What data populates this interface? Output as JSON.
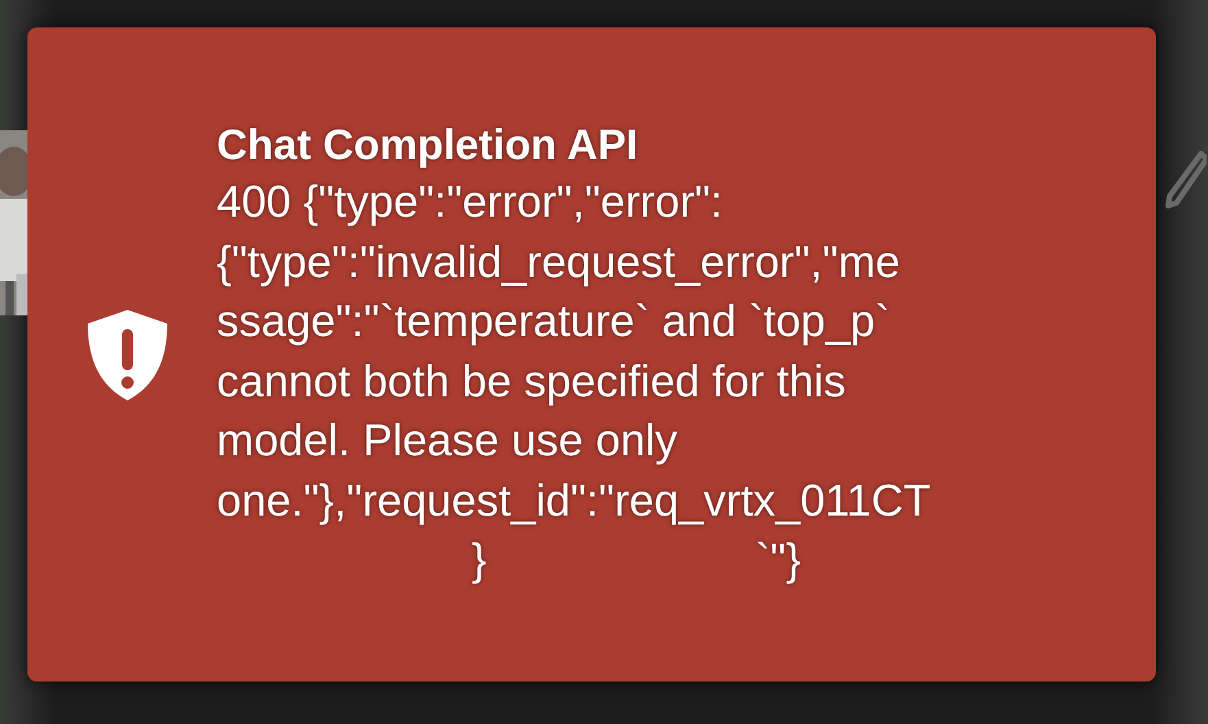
{
  "toast": {
    "kind": "error",
    "title": "Chat Completion API",
    "message_lines": [
      "400 {\"type\":\"error\",\"error\":",
      "{\"type\":\"invalid_request_error\",\"me",
      "ssage\":\"`temperature` and `top_p`",
      "cannot both be specified for this",
      "model. Please use only",
      "one.\"},\"request_id\":\"req_vrtx_011CT"
    ],
    "trailing_fragments": [
      "}",
      "`\"}"
    ]
  }
}
